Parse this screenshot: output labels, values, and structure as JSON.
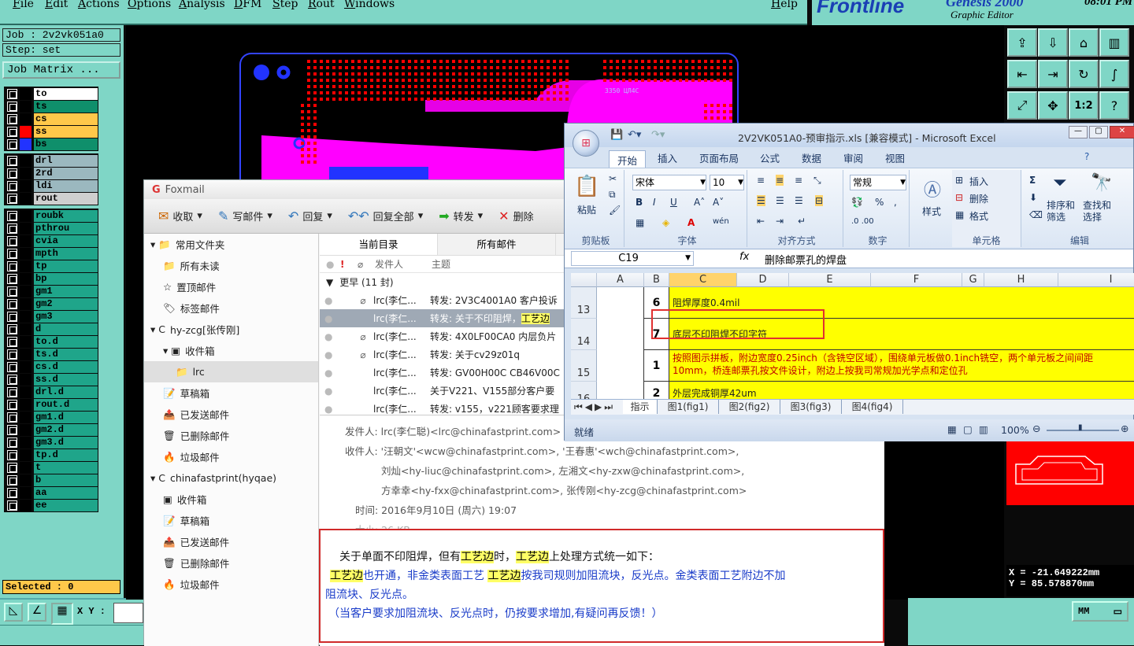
{
  "genesis": {
    "menu": [
      "File",
      "Edit",
      "Actions",
      "Options",
      "Analysis",
      "DFM",
      "Step",
      "Rout",
      "Windows",
      "Help"
    ],
    "logo_text": "Frontline",
    "product_text": "Genesis 2000",
    "subtitle": "Graphic Editor",
    "clock": "08:01 PM",
    "job": "Job : 2v2vk051a0",
    "step": "Step: set",
    "job_matrix_button": "Job Matrix ...",
    "layers_group1": [
      {
        "name": "to",
        "color": "#ffffff"
      },
      {
        "name": "ts",
        "color": "#0f8f6b"
      },
      {
        "name": "cs",
        "color": "#ffc84a"
      },
      {
        "name": "ss",
        "color": "#ffc84a"
      },
      {
        "name": "bs",
        "color": "#0f8f6b"
      }
    ],
    "layers_group2": [
      "drl",
      "2rd",
      "ldi",
      "rout"
    ],
    "layers_group3": [
      "roubk",
      "pthrou",
      "cvia",
      "mpth",
      "tp",
      "bp",
      "gm1",
      "gm2",
      "gm3",
      "d",
      "to.d",
      "ts.d",
      "cs.d",
      "ss.d",
      "drl.d",
      "rout.d",
      "gm1.d",
      "gm2.d",
      "gm3.d",
      "tp.d",
      "t",
      "b",
      "aa",
      "ee"
    ],
    "selected": "Selected : 0",
    "xy_label": "X Y :",
    "coord_x": "X = -21.649222mm",
    "coord_y": "Y = 85.578870mm",
    "units": "MM",
    "board_text": "3350 ЦЛ4С"
  },
  "foxmail": {
    "title": "Foxmail",
    "toolbar": [
      {
        "label": "收取",
        "icon": "inbox-icon"
      },
      {
        "label": "写邮件",
        "icon": "pen-icon"
      },
      {
        "label": "回复",
        "icon": "reply-icon"
      },
      {
        "label": "回复全部",
        "icon": "reply-all-icon"
      },
      {
        "label": "转发",
        "icon": "forward-icon"
      },
      {
        "label": "删除",
        "icon": "delete-icon"
      }
    ],
    "sidebar": [
      {
        "label": "常用文件夹",
        "level": 0,
        "icon": "▾ 📁"
      },
      {
        "label": "所有未读",
        "level": 1,
        "icon": "📁"
      },
      {
        "label": "置顶邮件",
        "level": 1,
        "icon": "☆"
      },
      {
        "label": "标签邮件",
        "level": 1,
        "icon": "🏷"
      },
      {
        "label": "hy-zcg[张传刚]",
        "level": 0,
        "icon": "▾ C"
      },
      {
        "label": "收件箱",
        "level": 1,
        "icon": "▾ ▣"
      },
      {
        "label": "lrc",
        "level": 2,
        "icon": "📁",
        "selected": true
      },
      {
        "label": "草稿箱",
        "level": 1,
        "icon": "📝"
      },
      {
        "label": "已发送邮件",
        "level": 1,
        "icon": "📤"
      },
      {
        "label": "已删除邮件",
        "level": 1,
        "icon": "🗑"
      },
      {
        "label": "垃圾邮件",
        "level": 1,
        "icon": "🔥"
      },
      {
        "label": "chinafastprint(hyqae)",
        "level": 0,
        "icon": "▾ C"
      },
      {
        "label": "收件箱",
        "level": 1,
        "icon": "▣"
      },
      {
        "label": "草稿箱",
        "level": 1,
        "icon": "📝"
      },
      {
        "label": "已发送邮件",
        "level": 1,
        "icon": "📤"
      },
      {
        "label": "已删除邮件",
        "level": 1,
        "icon": "🗑"
      },
      {
        "label": "垃圾邮件",
        "level": 1,
        "icon": "🔥"
      }
    ],
    "tabs": [
      "当前目录",
      "所有邮件"
    ],
    "col_from": "发件人",
    "col_subject": "主题",
    "group_label": "更早 (11 封)",
    "mails": [
      {
        "from": "lrc(李仁...",
        "subject": "转发: 2V3C4001A0 客户投诉",
        "att": true,
        "selected": false
      },
      {
        "from": "lrc(李仁...",
        "subject": "转发: 关于不印阻焊，",
        "subject_hl": "工艺边",
        "att": false,
        "selected": true
      },
      {
        "from": "lrc(李仁...",
        "subject": "转发: 4X0LF00CA0  内层负片",
        "att": true,
        "selected": false
      },
      {
        "from": "lrc(李仁...",
        "subject": "转发: 关于cv29z01q",
        "att": true,
        "selected": false
      },
      {
        "from": "lrc(李仁...",
        "subject": "转发: GV00H00C  CB46V00C",
        "att": false,
        "selected": false
      },
      {
        "from": "lrc(李仁...",
        "subject": "关于V221、V155部分客户要",
        "att": false,
        "selected": false
      },
      {
        "from": "lrc(李仁...",
        "subject": "转发: v155，v221顾客要求理",
        "att": false,
        "selected": false
      }
    ],
    "preview": {
      "from": "发件人: lrc(李仁聪)<lrc@chinafastprint.com>",
      "to1": "收件人: '汪朝文'<wcw@chinafastprint.com>, '王春惠'<wch@chinafastprint.com>,",
      "to2": "刘灿<hy-liuc@chinafastprint.com>, 左湘文<hy-zxw@chinafastprint.com>,",
      "to3": "方幸幸<hy-fxx@chinafastprint.com>, 张传刚<hy-zcg@chinafastprint.com>",
      "time": "时间: 2016年9月10日 (周六) 19:07",
      "size": "大小: 26 KB",
      "body1_a": "关于单面不印阻焊，但有",
      "body1_hl1": "工艺边",
      "body1_b": "时，",
      "body1_hl2": "工艺边",
      "body1_c": "上处理方式统一如下：",
      "body2_hl1": "工艺边",
      "body2_a": "也开通，非金类表面工艺  ",
      "body2_hl2": "工艺边",
      "body2_b": "按我司规则加阻流块，反光点。金类表面工艺附边不加",
      "body3": "阻流块、反光点。",
      "body4": "（当客户要求加阻流块、反光点时，仍按要求增加,有疑问再反馈！）"
    }
  },
  "excel": {
    "title": "2V2VK051A0-预审指示.xls  [兼容模式] - Microsoft Excel",
    "tabs": [
      "开始",
      "插入",
      "页面布局",
      "公式",
      "数据",
      "审阅",
      "视图"
    ],
    "groups": [
      "剪贴板",
      "字体",
      "对齐方式",
      "数字",
      "单元格",
      "编辑"
    ],
    "paste": "粘贴",
    "font_name": "宋体",
    "font_size": "10",
    "number_format": "常规",
    "styles": "样式",
    "insert": "插入",
    "delete": "删除",
    "format": "格式",
    "sort": "排序和\n筛选",
    "find": "查找和\n选择",
    "namebox": "C19",
    "formula": "删除邮票孔的焊盘",
    "columns": [
      "A",
      "B",
      "C",
      "D",
      "E",
      "F",
      "G",
      "H",
      "I"
    ],
    "rows": [
      {
        "row": "13",
        "num": "6",
        "text": "阻焊厚度0.4mil"
      },
      {
        "row": "14",
        "num": "7",
        "text": "底层不印阻焊不印字符"
      },
      {
        "row": "15",
        "num": "1",
        "text": "按照图示拼板，附边宽度0.25inch（含铣空区域），围绕单元板做0.1inch铣空，两个单元板之间间距",
        "text2": "10mm，桥连邮票孔按文件设计，附边上按我司常规加光学点和定位孔"
      },
      {
        "row": "16",
        "num": "2",
        "text": "外层完成铜厚42um"
      }
    ],
    "sheet_tabs": [
      "指示",
      "图1(fig1)",
      "图2(fig2)",
      "图3(fig3)",
      "图4(fig4)"
    ],
    "status": "就绪",
    "zoom": "100%"
  }
}
